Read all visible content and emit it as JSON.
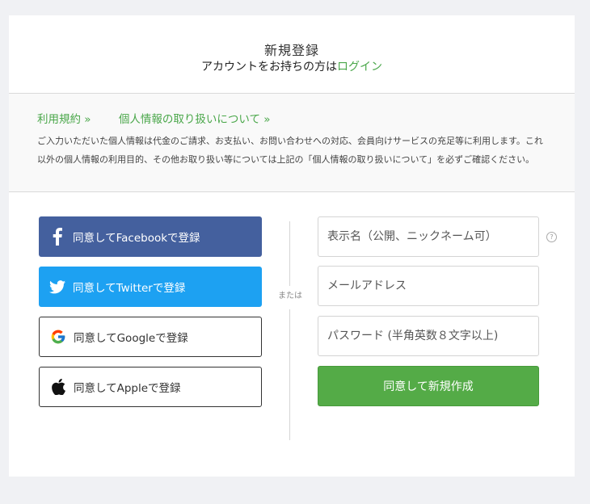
{
  "header": {
    "title": "新規登録",
    "login_prefix": "アカウントをお持ちの方は",
    "login_link": "ログイン"
  },
  "terms": {
    "terms_link": "利用規約 »",
    "privacy_link": "個人情報の取り扱いについて »",
    "notice_text": "ご入力いただいた個人情報は代金のご請求、お支払い、お問い合わせへの対応、会員向けサービスの充足等に利用します。これ以外の個人情報の利用目的、その他お取り扱い等については上記の「個人情報の取り扱いについて」を必ずご確認ください。"
  },
  "social": {
    "facebook_label": "同意してFacebookで登録",
    "twitter_label": "同意してTwitterで登録",
    "google_label": "同意してGoogleで登録",
    "apple_label": "同意してAppleで登録"
  },
  "divider": {
    "or_label": "または"
  },
  "form": {
    "display_name_placeholder": "表示名（公開、ニックネーム可）",
    "email_placeholder": "メールアドレス",
    "password_placeholder": "パスワード (半角英数８文字以上)",
    "help_symbol": "?",
    "submit_label": "同意して新規作成"
  },
  "colors": {
    "accent_green": "#4aa74a",
    "submit_green": "#54ab47",
    "facebook_blue": "#44609e",
    "twitter_blue": "#1da1f2"
  }
}
